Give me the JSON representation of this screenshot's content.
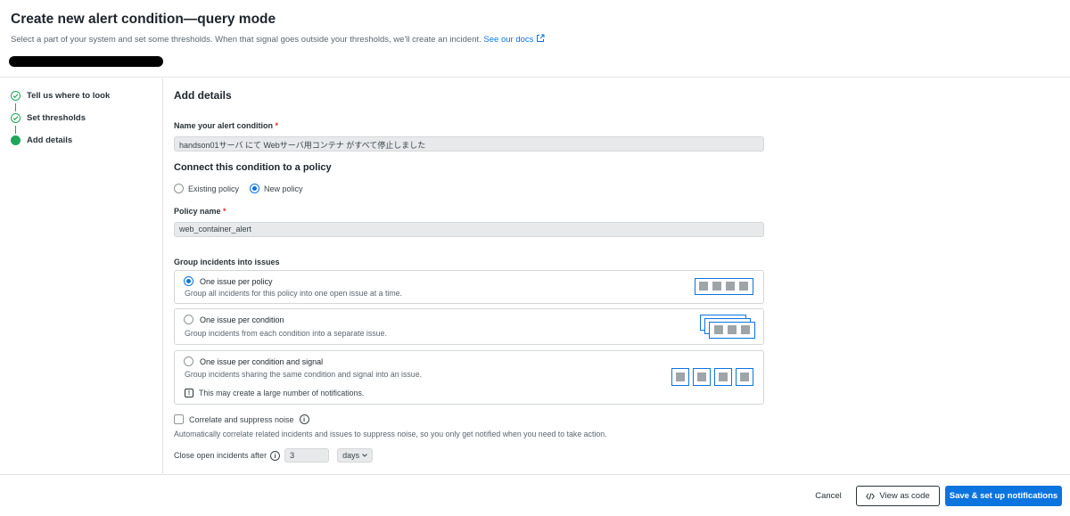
{
  "header": {
    "title": "Create new alert condition—query mode",
    "subtitle": "Select a part of your system and set some thresholds. When that signal goes outside your thresholds, we'll create an incident.",
    "docs_link": "See our docs"
  },
  "steps": [
    {
      "label": "Tell us where to look",
      "state": "done"
    },
    {
      "label": "Set thresholds",
      "state": "done"
    },
    {
      "label": "Add details",
      "state": "active"
    }
  ],
  "main": {
    "section_title": "Add details",
    "condition_name_label": "Name your alert condition",
    "condition_name_value": "handson01サーバ にて Webサーバ用コンテナ がすべて停止しました",
    "policy_heading": "Connect this condition to a policy",
    "policy_options": [
      "Existing policy",
      "New policy"
    ],
    "policy_selected": "New policy",
    "policy_name_label": "Policy name",
    "policy_name_value": "web_container_alert",
    "group_heading": "Group incidents into issues",
    "group_options": [
      {
        "title": "One issue per policy",
        "desc": "Group all incidents for this policy into one open issue at a time.",
        "selected": true
      },
      {
        "title": "One issue per condition",
        "desc": "Group incidents from each condition into a separate issue.",
        "selected": false
      },
      {
        "title": "One issue per condition and signal",
        "desc": "Group incidents sharing the same condition and signal into an issue.",
        "selected": false,
        "warning": "This may create a large number of notifications."
      }
    ],
    "correlate_label": "Correlate and suppress noise",
    "correlate_help": "Automatically correlate related incidents and issues to suppress noise, so you only get notified when you need to take action.",
    "close_label": "Close open incidents after",
    "close_value": "3",
    "close_unit": "days"
  },
  "footer": {
    "cancel": "Cancel",
    "view_code": "View as code",
    "save": "Save & set up notifications"
  },
  "colors": {
    "accent": "#0c74df",
    "success": "#1ea65b",
    "required": "#df2d24"
  }
}
